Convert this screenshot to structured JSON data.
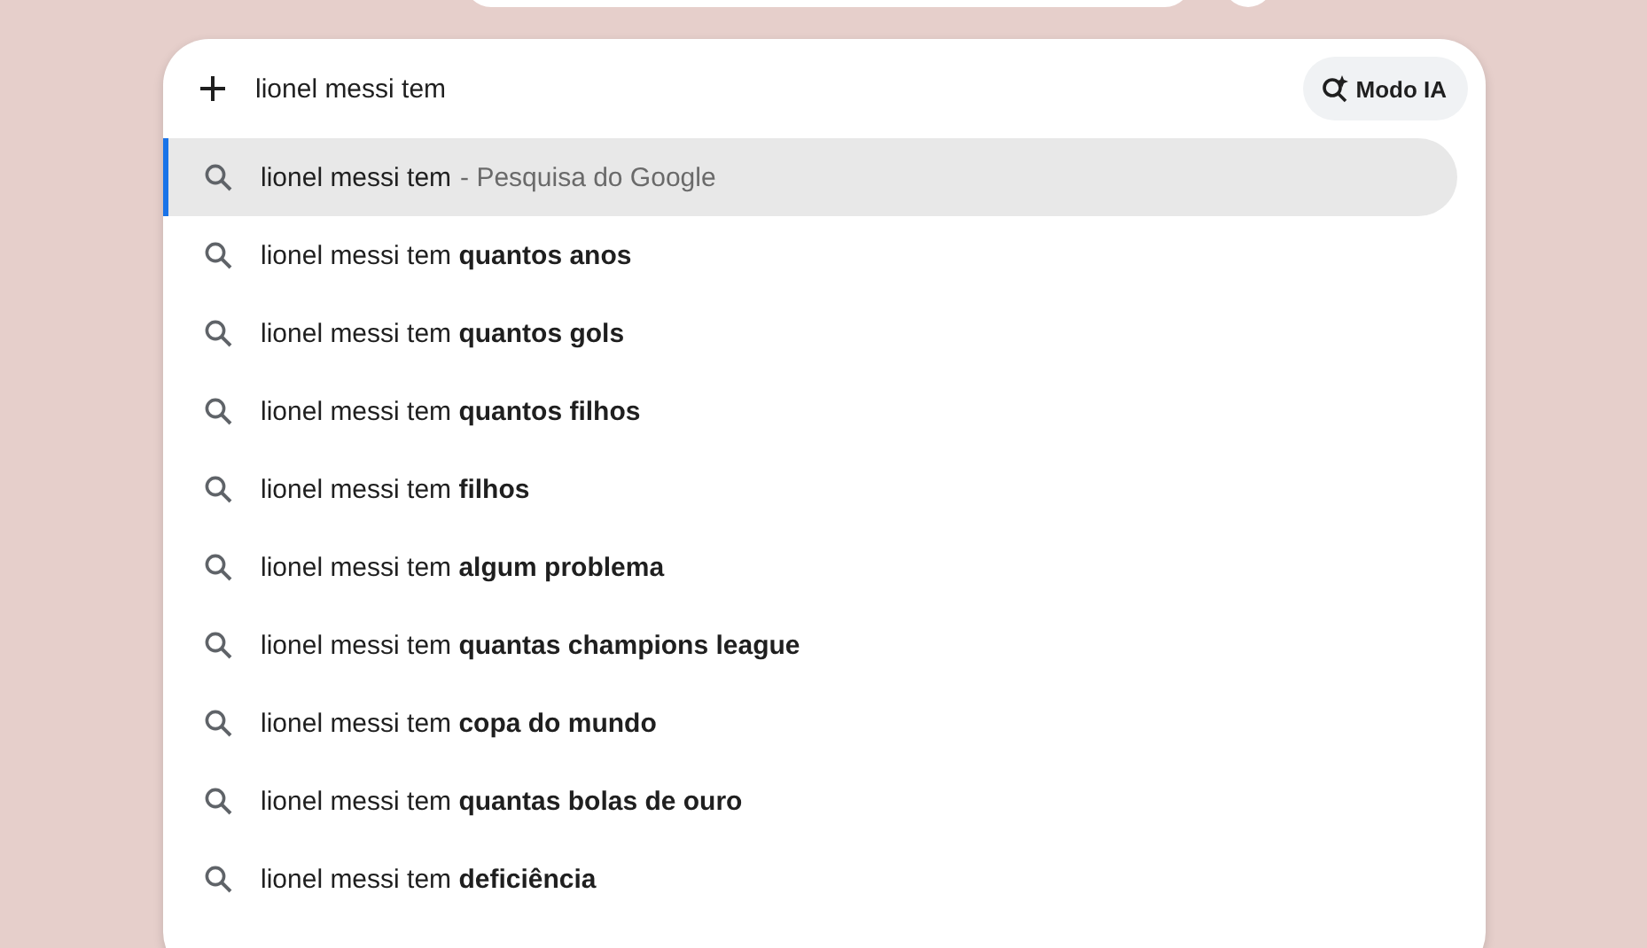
{
  "search": {
    "value": "lionel messi tem ",
    "ai_button": "Modo IA"
  },
  "suggestions": [
    {
      "text": "lionel messi tem",
      "suffix": "- Pesquisa do Google",
      "selected": true
    },
    {
      "text": "lionel messi tem **quantos anos**",
      "selected": false
    },
    {
      "text": "lionel messi tem **quantos gols**",
      "selected": false
    },
    {
      "text": "lionel messi tem **quantos filhos**",
      "selected": false
    },
    {
      "text": "lionel messi tem **filhos**",
      "selected": false
    },
    {
      "text": "lionel messi tem **algum problema**",
      "selected": false
    },
    {
      "text": "lionel messi tem **quantas champions league**",
      "selected": false
    },
    {
      "text": "lionel messi tem **copa do mundo**",
      "selected": false
    },
    {
      "text": "lionel messi tem **quantas bolas de ouro**",
      "selected": false
    },
    {
      "text": "lionel messi tem **deficiência**",
      "selected": false
    }
  ]
}
